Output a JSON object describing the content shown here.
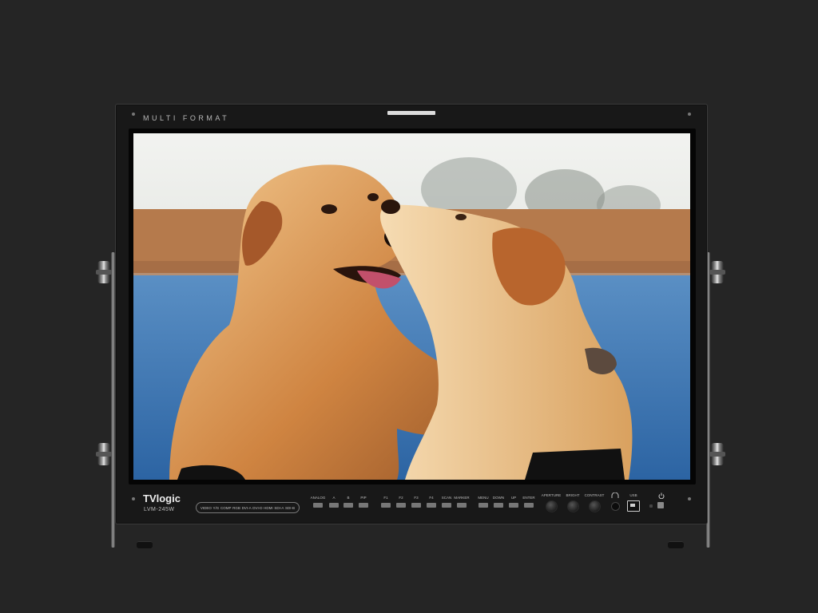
{
  "monitor": {
    "header_text": "MULTI FORMAT",
    "brand": "TVlogic",
    "model": "LVM-245W",
    "inputs": [
      "VIDEO",
      "Y/G",
      "COMP",
      "RGB",
      "DVI-A",
      "DVI-D",
      "HDMI",
      "SDI-A",
      "SDI-B"
    ],
    "controls": {
      "analog_label": "ANALOG",
      "ab_a": "A",
      "ab_b": "B",
      "pip_label": "PIP",
      "f1": "F1",
      "f2": "F2",
      "f3": "F3",
      "f4": "F4",
      "scan_label": "SCAN",
      "marker_label": "MARKER",
      "menu_label": "MENU",
      "down_label": "DOWN",
      "up_label": "UP",
      "enter_label": "ENTER",
      "aperture_label": "APERTURE",
      "bright_label": "BRIGHT",
      "contrast_label": "CONTRAST",
      "usb_label": "USB"
    }
  },
  "screen_image": {
    "subject": "two-labrador-dogs",
    "colors": {
      "sky": "#e8ecea",
      "field": "#b77a4a",
      "water": "#3d78b6",
      "fur": "#d08a4a",
      "fur_light": "#efc897"
    }
  },
  "icons": [
    "headphone-icon",
    "usb-icon",
    "power-icon"
  ]
}
